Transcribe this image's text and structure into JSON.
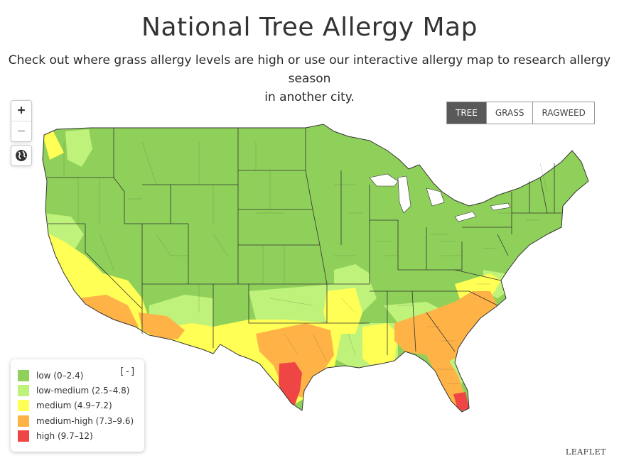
{
  "header": {
    "title": "National Tree Allergy Map",
    "subtitle_line1": "Check out where grass allergy levels are high or use our interactive allergy map to research allergy season",
    "subtitle_line2": "in another city."
  },
  "map_controls": {
    "zoom_in": "+",
    "zoom_out": "−",
    "locate_icon": "globe-icon"
  },
  "tabs": [
    {
      "label": "TREE",
      "active": true
    },
    {
      "label": "GRASS",
      "active": false
    },
    {
      "label": "RAGWEED",
      "active": false
    }
  ],
  "legend": {
    "collapse_label": "[-]",
    "items": [
      {
        "label": "low (0–2.4)",
        "color": "#8fd05a"
      },
      {
        "label": "low-medium (2.5–4.8)",
        "color": "#bff27a"
      },
      {
        "label": "medium (4.9–7.2)",
        "color": "#ffff55"
      },
      {
        "label": "medium-high (7.3–9.6)",
        "color": "#ffb347"
      },
      {
        "label": "high (9.7–12)",
        "color": "#f04545"
      }
    ]
  },
  "attribution": "LEAFLET",
  "colors": {
    "low": "#8fd05a",
    "low_medium": "#bff27a",
    "medium": "#ffff55",
    "medium_high": "#ffb347",
    "high": "#f04545",
    "boundary": "#333333"
  }
}
